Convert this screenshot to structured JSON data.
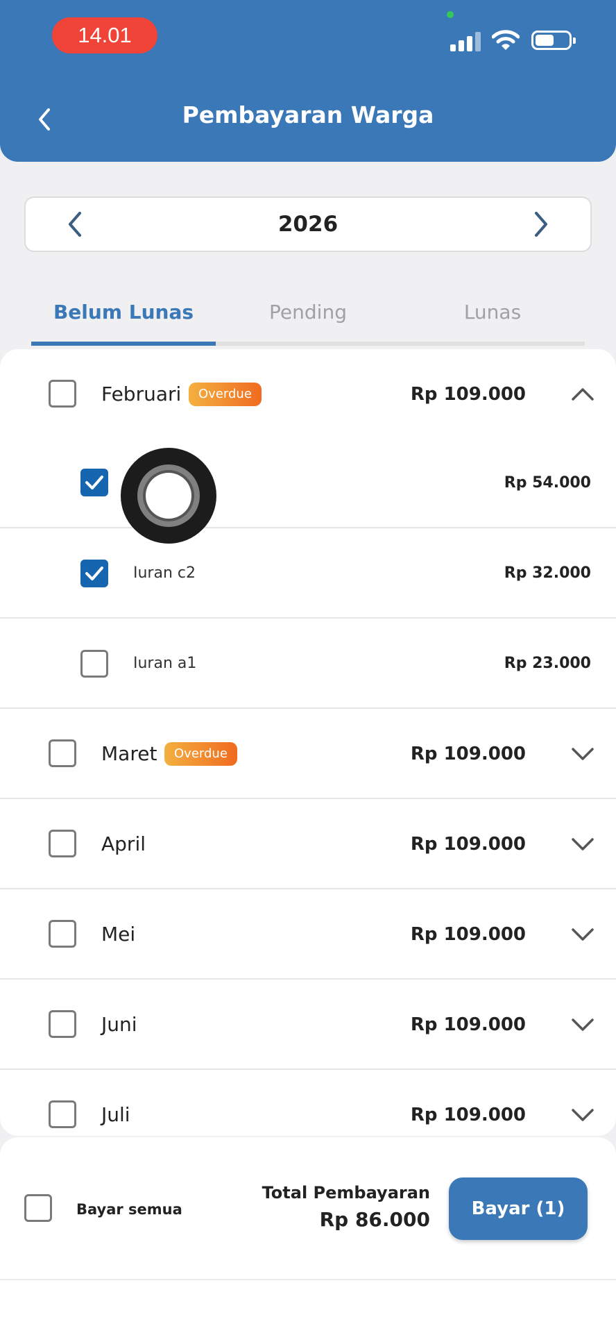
{
  "status_bar": {
    "time": "14.01"
  },
  "header": {
    "title": "Pembayaran Warga"
  },
  "year_selector": {
    "year": "2026"
  },
  "tabs": [
    {
      "label": "Belum Lunas",
      "active": true
    },
    {
      "label": "Pending",
      "active": false
    },
    {
      "label": "Lunas",
      "active": false
    }
  ],
  "months": [
    {
      "name": "Februari",
      "badge": "Overdue",
      "amount": "Rp 109.000",
      "expanded": true,
      "checked": false,
      "items": [
        {
          "label": "",
          "amount": "Rp 54.000",
          "checked": true
        },
        {
          "label": "Iuran c2",
          "amount": "Rp 32.000",
          "checked": true
        },
        {
          "label": "Iuran a1",
          "amount": "Rp 23.000",
          "checked": false
        }
      ]
    },
    {
      "name": "Maret",
      "badge": "Overdue",
      "amount": "Rp 109.000",
      "expanded": false,
      "checked": false
    },
    {
      "name": "April",
      "badge": "",
      "amount": "Rp 109.000",
      "expanded": false,
      "checked": false
    },
    {
      "name": "Mei",
      "badge": "",
      "amount": "Rp 109.000",
      "expanded": false,
      "checked": false
    },
    {
      "name": "Juni",
      "badge": "",
      "amount": "Rp 109.000",
      "expanded": false,
      "checked": false
    },
    {
      "name": "Juli",
      "badge": "",
      "amount": "Rp 109.000",
      "expanded": false,
      "checked": false
    }
  ],
  "footer": {
    "pay_all_label": "Bayar semua",
    "total_label": "Total Pembayaran",
    "total_value": "Rp 86.000",
    "pay_button": "Bayar (1)"
  },
  "colors": {
    "primary": "#3a78b8",
    "checkbox_checked": "#1565b0",
    "badge_start": "#f4b040",
    "badge_end": "#ef6b20",
    "status_time_bg": "#f04438"
  }
}
